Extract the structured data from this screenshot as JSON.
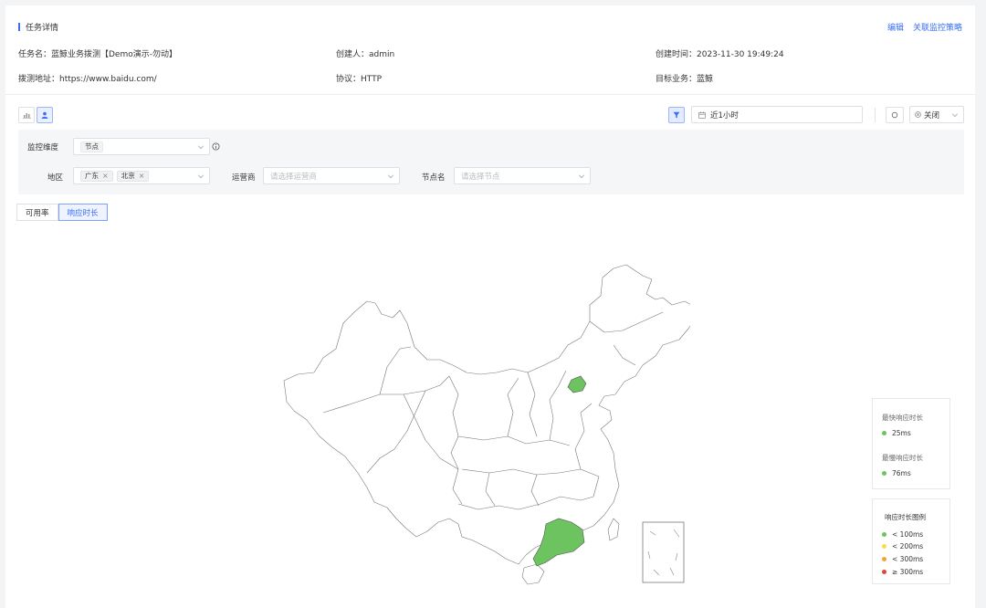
{
  "header": {
    "title": "任务详情",
    "edit": "编辑",
    "link_policy": "关联监控策略"
  },
  "info": {
    "task_name": "任务名：蓝鲸业务拨测【Demo演示-勿动】",
    "creator": "创建人：admin",
    "created_time": "创建时间：2023-11-30 19:49:24",
    "url": "拨测地址：https://www.baidu.com/",
    "protocol": "协议：HTTP",
    "target_biz": "目标业务：蓝鲸"
  },
  "toolbar": {
    "time_range": "近1小时",
    "refresh_mode": "关闭"
  },
  "filters": {
    "dimension_label": "监控维度",
    "dimension_value": "节点",
    "region_label": "地区",
    "region_tags": [
      "广东",
      "北京"
    ],
    "isp_label": "运营商",
    "isp_placeholder": "请选择运营商",
    "node_label": "节点名",
    "node_placeholder": "请选择节点"
  },
  "tabs": {
    "availability": "可用率",
    "response_time": "响应时长"
  },
  "stats": {
    "fastest_label": "最快响应时长",
    "fastest_value": "25ms",
    "slowest_label": "最慢响应时长",
    "slowest_value": "76ms"
  },
  "legend": {
    "title": "响应时长图例",
    "items": [
      "< 100ms",
      "< 200ms",
      "< 300ms",
      "≥ 300ms"
    ]
  },
  "colors": {
    "accent": "#3a6ff7",
    "good": "#6cc35f",
    "warn": "#f5e04a",
    "orange": "#f0a33a",
    "bad": "#d9483b"
  }
}
